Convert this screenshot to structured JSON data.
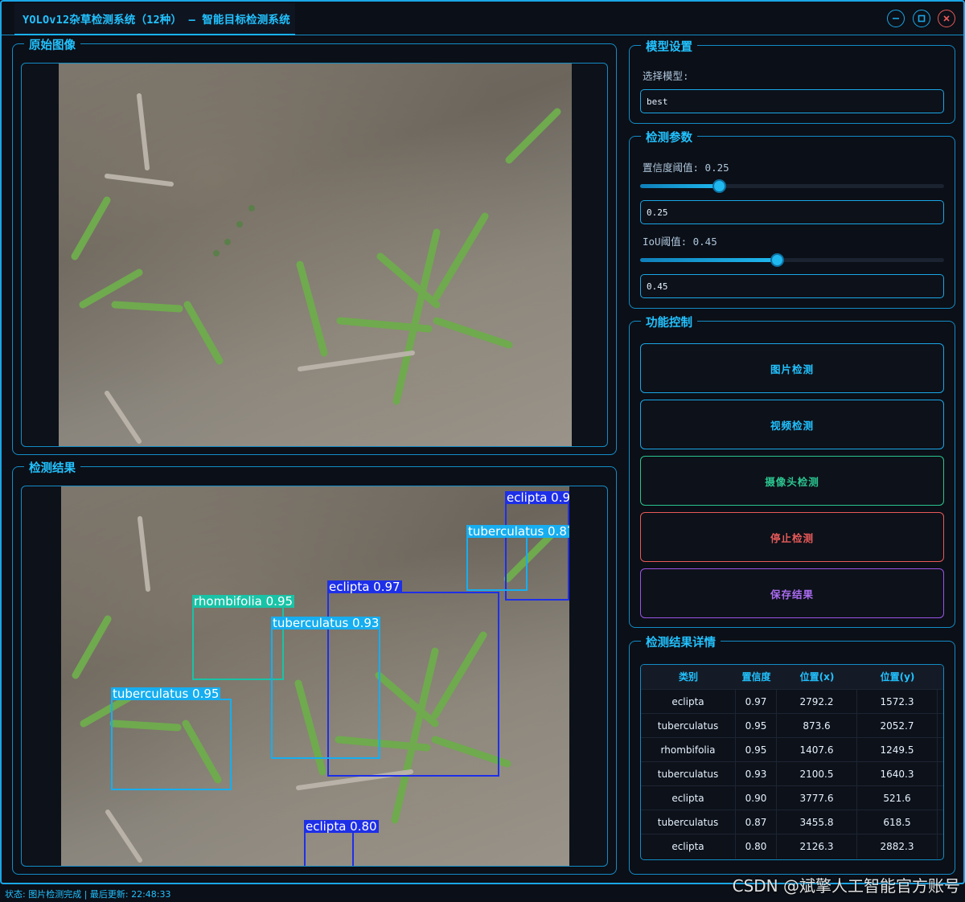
{
  "window": {
    "title": "YOLOv12杂草检测系统（12种） – 智能目标检测系统"
  },
  "panels": {
    "original_title": "原始图像",
    "result_title": "检测结果",
    "model_title": "模型设置",
    "params_title": "检测参数",
    "control_title": "功能控制",
    "details_title": "检测结果详情"
  },
  "model": {
    "select_label": "选择模型:",
    "selected": "best"
  },
  "params": {
    "confidence_label": "置信度阈值: 0.25",
    "confidence_value": "0.25",
    "confidence_slider": 0.25,
    "iou_label": "IoU阈值: 0.45",
    "iou_value": "0.45",
    "iou_slider": 0.45
  },
  "controls": {
    "image_detect": "图片检测",
    "video_detect": "视频检测",
    "camera_detect": "摄像头检测",
    "stop_detect": "停止检测",
    "save_result": "保存结果"
  },
  "colors": {
    "accent": "#22c2ff",
    "image_btn": "#1aa6e6",
    "video_btn": "#1aa6e6",
    "camera_btn": "#2bc48f",
    "stop_btn": "#e85a5a",
    "save_btn": "#9c54e8",
    "eclipta": "#1e2fe8",
    "tuberculatus": "#16aef0",
    "rhombifolia": "#19c3a6"
  },
  "detections": [
    {
      "label": "eclipta 0.90",
      "class": "eclipta"
    },
    {
      "label": "tuberculatus 0.87",
      "class": "tuberculatus"
    },
    {
      "label": "eclipta 0.97",
      "class": "eclipta"
    },
    {
      "label": "rhombifolia 0.95",
      "class": "rhombifolia"
    },
    {
      "label": "tuberculatus 0.93",
      "class": "tuberculatus"
    },
    {
      "label": "tuberculatus 0.95",
      "class": "tuberculatus"
    },
    {
      "label": "eclipta 0.80",
      "class": "eclipta"
    }
  ],
  "table": {
    "headers": [
      "类别",
      "置信度",
      "位置(x)",
      "位置(y)"
    ],
    "rows": [
      [
        "eclipta",
        "0.97",
        "2792.2",
        "1572.3"
      ],
      [
        "tuberculatus",
        "0.95",
        "873.6",
        "2052.7"
      ],
      [
        "rhombifolia",
        "0.95",
        "1407.6",
        "1249.5"
      ],
      [
        "tuberculatus",
        "0.93",
        "2100.5",
        "1640.3"
      ],
      [
        "eclipta",
        "0.90",
        "3777.6",
        "521.6"
      ],
      [
        "tuberculatus",
        "0.87",
        "3455.8",
        "618.5"
      ],
      [
        "eclipta",
        "0.80",
        "2126.3",
        "2882.3"
      ]
    ]
  },
  "status": {
    "text": "状态: 图片检测完成 | 最后更新: 22:48:33"
  },
  "watermark": "CSDN @斌擎人工智能官方账号"
}
